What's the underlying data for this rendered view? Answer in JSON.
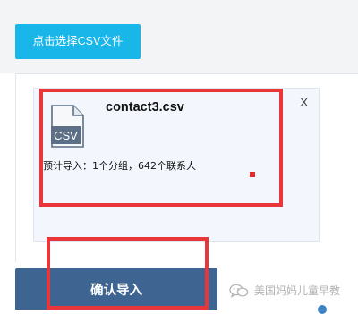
{
  "upload": {
    "select_button_label": "点击选择CSV文件"
  },
  "file_card": {
    "file_name": "contact3.csv",
    "icon_label": "CSV",
    "close_label": "X",
    "summary": "预计导入：1个分组，642个联系人"
  },
  "actions": {
    "confirm_label": "确认导入"
  },
  "watermark": {
    "text": "美国妈妈儿童早教",
    "icon": "wechat-icon"
  },
  "colors": {
    "select_button": "#19b6ea",
    "confirm_button": "#3e6592",
    "highlight": "#e8363a",
    "card_background": "#f3f6fd"
  }
}
